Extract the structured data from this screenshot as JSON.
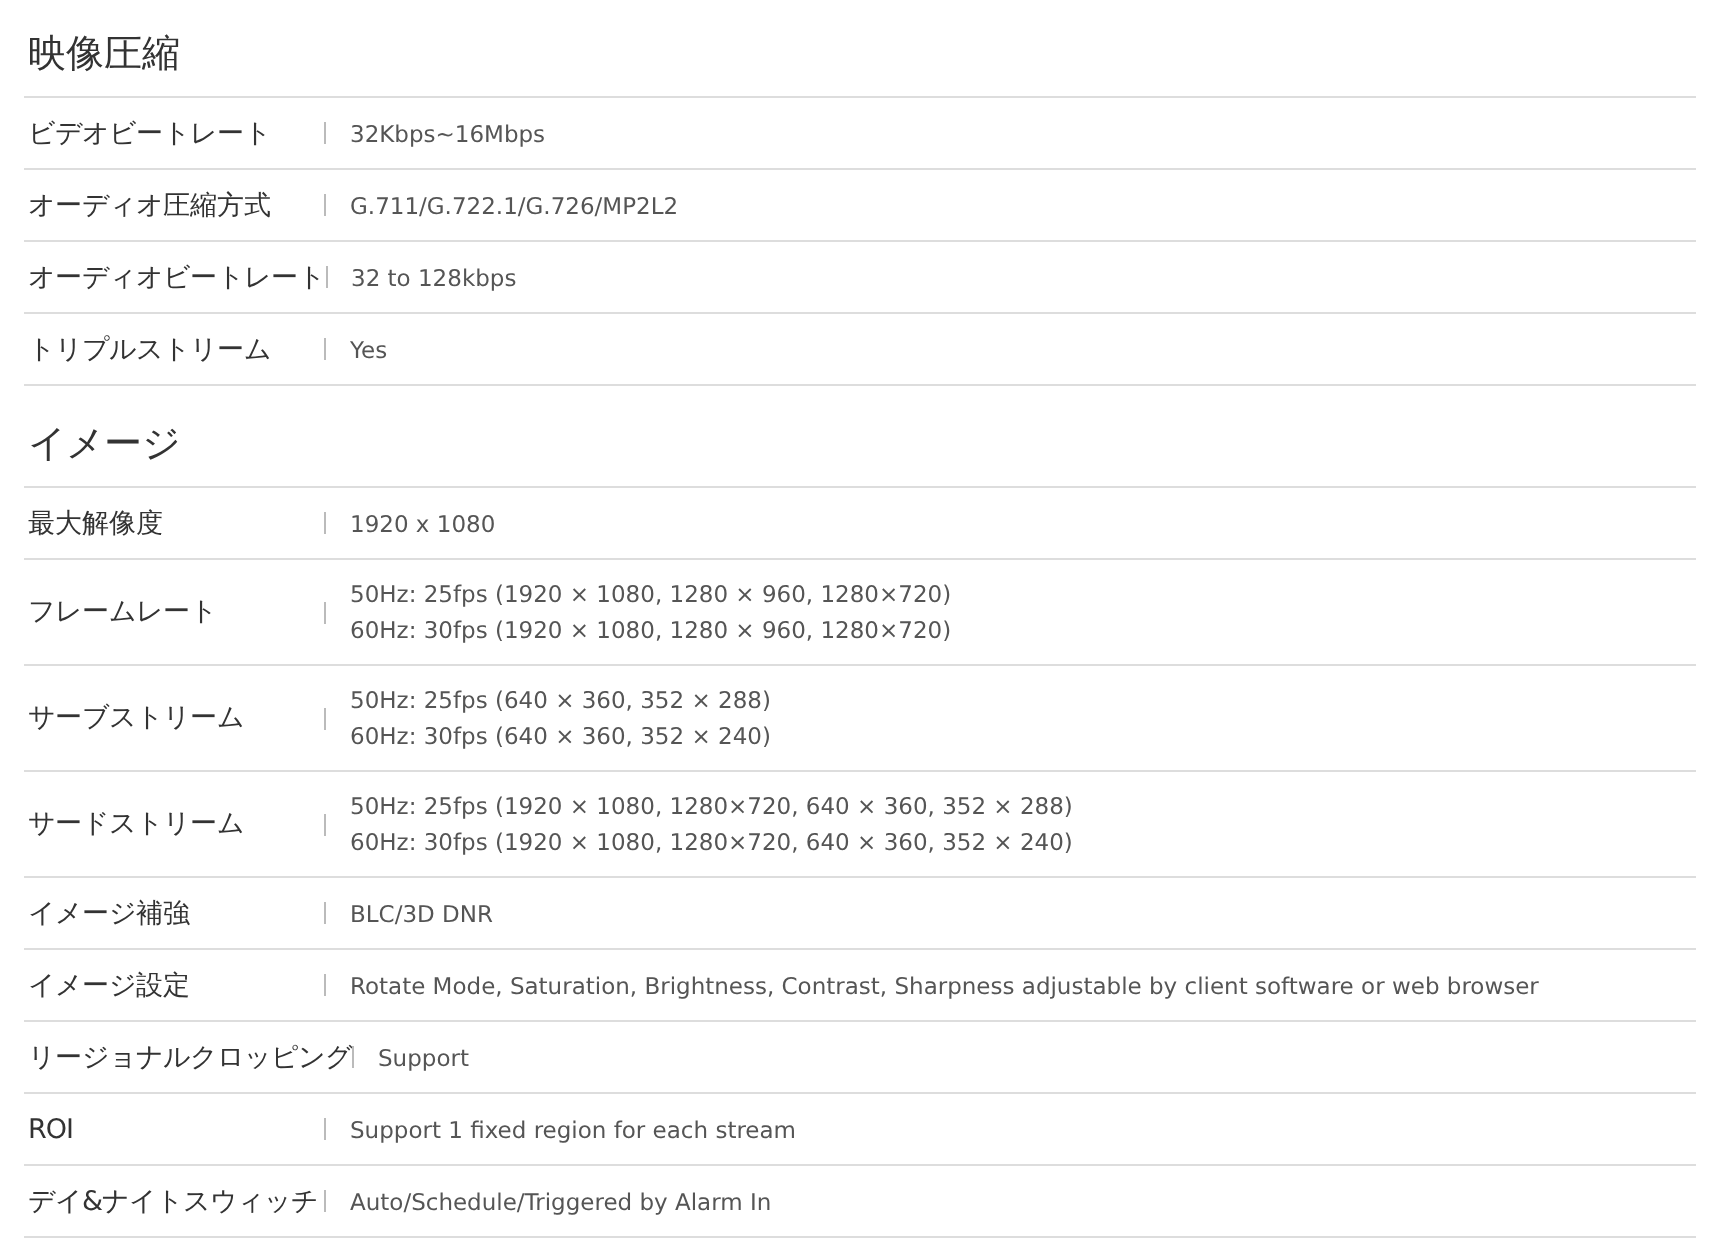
{
  "sections": [
    {
      "title": "映像圧縮",
      "rows": [
        {
          "label": "ビデオビートレート",
          "values": [
            "32Kbps~16Mbps"
          ]
        },
        {
          "label": "オーディオ圧縮方式",
          "values": [
            "G.711/G.722.1/G.726/MP2L2"
          ]
        },
        {
          "label": "オーディオビートレート",
          "values": [
            "32 to 128kbps"
          ]
        },
        {
          "label": "トリプルストリーム",
          "values": [
            "Yes"
          ]
        }
      ]
    },
    {
      "title": "イメージ",
      "rows": [
        {
          "label": "最大解像度",
          "values": [
            "1920 x 1080"
          ]
        },
        {
          "label": "フレームレート",
          "values": [
            "50Hz: 25fps (1920 × 1080, 1280 × 960, 1280×720)",
            "60Hz: 30fps (1920 × 1080, 1280 × 960, 1280×720)"
          ]
        },
        {
          "label": "サーブストリーム",
          "values": [
            "50Hz: 25fps (640 × 360, 352 × 288)",
            "60Hz: 30fps (640 × 360, 352 × 240)"
          ]
        },
        {
          "label": "サードストリーム",
          "values": [
            "50Hz: 25fps (1920 × 1080, 1280×720, 640 × 360, 352 × 288)",
            "60Hz: 30fps (1920 × 1080, 1280×720, 640 × 360, 352 × 240)"
          ]
        },
        {
          "label": "イメージ補強",
          "values": [
            "BLC/3D DNR"
          ]
        },
        {
          "label": "イメージ設定",
          "values": [
            "Rotate Mode, Saturation, Brightness, Contrast, Sharpness adjustable by client software or web browser"
          ]
        },
        {
          "label": "リージョナルクロッピング",
          "values": [
            "Support"
          ]
        },
        {
          "label": "ROI",
          "values": [
            "Support 1 fixed region for each stream"
          ]
        },
        {
          "label": "デイ&ナイトスウィッチ",
          "values": [
            "Auto/Schedule/Triggered by Alarm In"
          ]
        }
      ]
    }
  ]
}
